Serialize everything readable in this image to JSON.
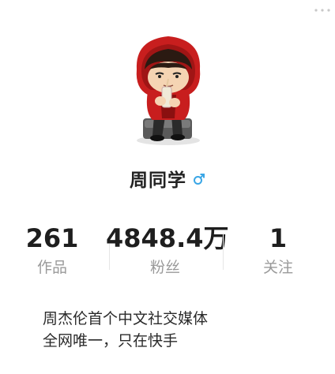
{
  "profile": {
    "name": "周同学",
    "gender_icon": "male-symbol-icon",
    "gender_color": "#3aa6e6"
  },
  "stats": {
    "works": {
      "value": "261",
      "label": "作品"
    },
    "fans": {
      "value": "4848.4万",
      "label": "粉丝"
    },
    "following": {
      "value": "1",
      "label": "关注"
    }
  },
  "bio": {
    "line1": "周杰伦首个中文社交媒体",
    "line2": "全网唯一，只在快手"
  },
  "colors": {
    "avatar_hood": "#c81e1e",
    "text_primary": "#222222",
    "text_secondary": "#9a9a9a"
  }
}
